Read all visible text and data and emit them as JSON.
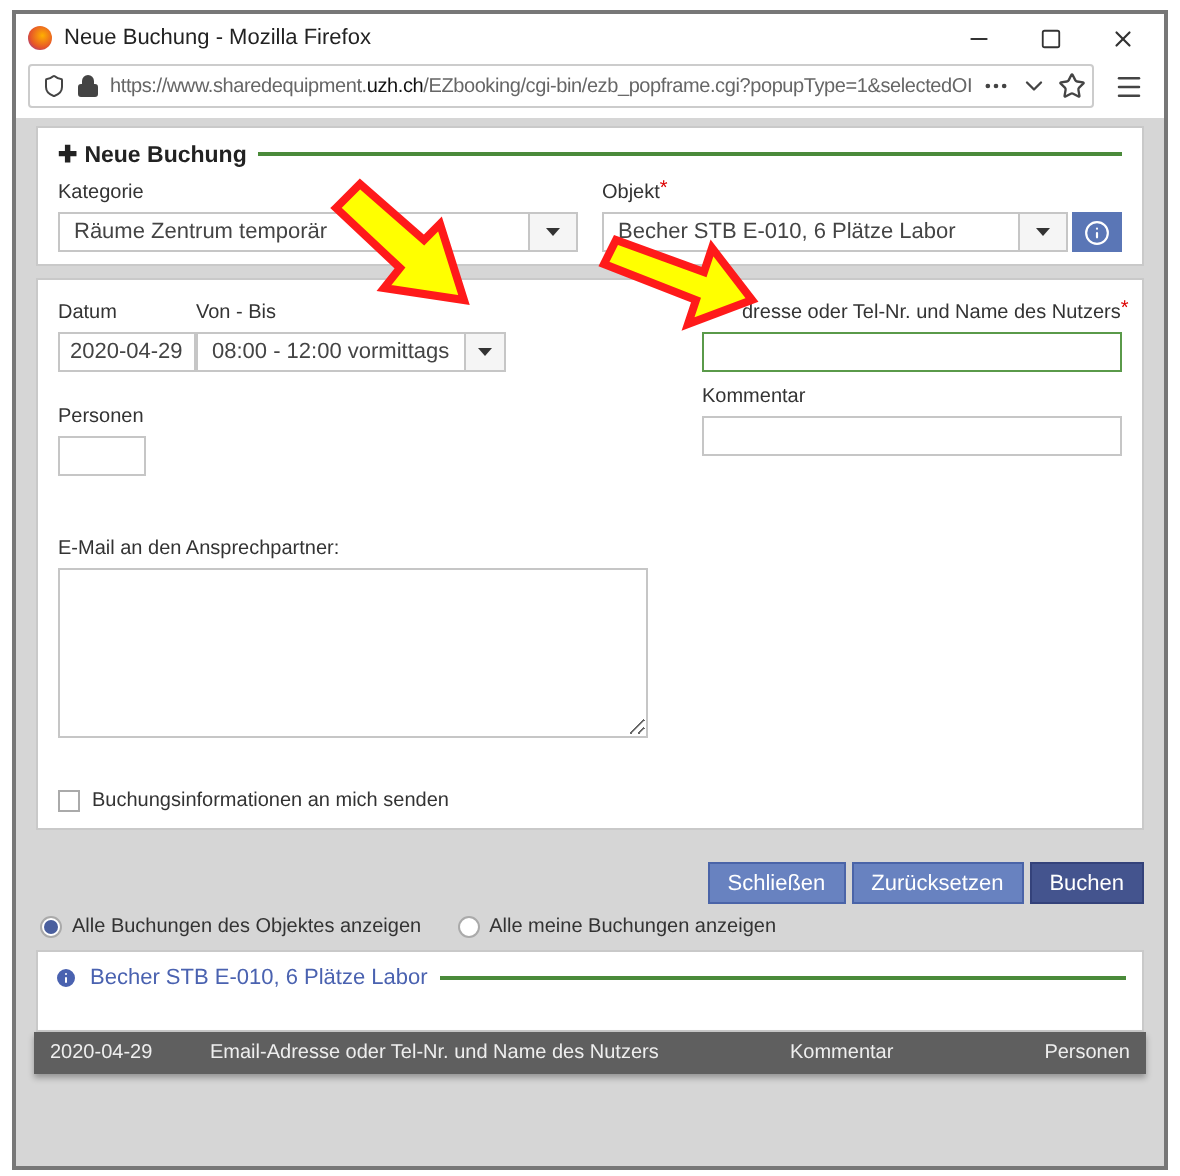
{
  "window": {
    "title": "Neue Buchung - Mozilla Firefox",
    "url_parts": [
      {
        "text": "https://www.sharedequipment.",
        "kind": "dim"
      },
      {
        "text": "uzh.ch",
        "kind": "host"
      },
      {
        "text": "/EZbooking/cgi-bin/ezb_popframe.cgi?popupType=1&selectedOI",
        "kind": "dim"
      }
    ]
  },
  "header": {
    "icon": "✚",
    "title": "Neue Buchung"
  },
  "kategorie": {
    "label": "Kategorie",
    "value": "Räume Zentrum temporär"
  },
  "objekt": {
    "label": "Objekt",
    "required_mark": "*",
    "value": "Becher STB E-010, 6 Plätze Labor"
  },
  "datum": {
    "label": "Datum",
    "value": "2020-04-29"
  },
  "von_bis": {
    "label": "Von - Bis",
    "value": "08:00 - 12:00 vormittags"
  },
  "nutzer": {
    "label": "dresse oder Tel-Nr. und Name des Nutzers",
    "required_mark": "*",
    "focused": true
  },
  "kommentar": {
    "label": "Kommentar"
  },
  "personen": {
    "label": "Personen"
  },
  "email": {
    "label": "E-Mail an den Ansprechpartner:"
  },
  "send_info": {
    "label": "Buchungsinformationen an mich senden",
    "checked": false
  },
  "buttons": [
    {
      "label": "Schließen",
      "kind": "secondary"
    },
    {
      "label": "Zurücksetzen",
      "kind": "secondary"
    },
    {
      "label": "Buchen",
      "kind": "primary"
    }
  ],
  "filters": [
    {
      "label": "Alle Buchungen des Objektes anzeigen",
      "selected": true
    },
    {
      "label": "Alle meine Buchungen anzeigen",
      "selected": false
    }
  ],
  "booking_list": {
    "title": "Becher STB E-010, 6 Plätze Labor",
    "columns": [
      "2020-04-29",
      "Email-Adresse oder Tel-Nr. und Name des Nutzers",
      "Kommentar",
      "Personen"
    ]
  }
}
